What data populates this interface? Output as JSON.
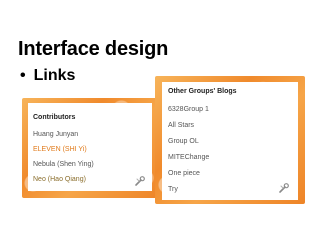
{
  "slide": {
    "title": "Interface design",
    "bullet": "Links",
    "bullet_marker": "•"
  },
  "contributors": {
    "title": "Contributors",
    "items": [
      "Huang Junyan",
      "ELEVEN (SHI Yi)",
      "Nebula (Shen Ying)",
      "Neo (Hao Qiang)"
    ]
  },
  "other_groups": {
    "title": "Other Groups' Blogs",
    "items": [
      "6328Group 1",
      "All Stars",
      "Group OL",
      "MITEChange",
      "One piece",
      "Try"
    ]
  },
  "colors": {
    "widget_orange": "#f08a2c",
    "link_orange": "#e07a1a",
    "text_gray": "#555555"
  },
  "icons": [
    "edit-wrench-icon"
  ]
}
